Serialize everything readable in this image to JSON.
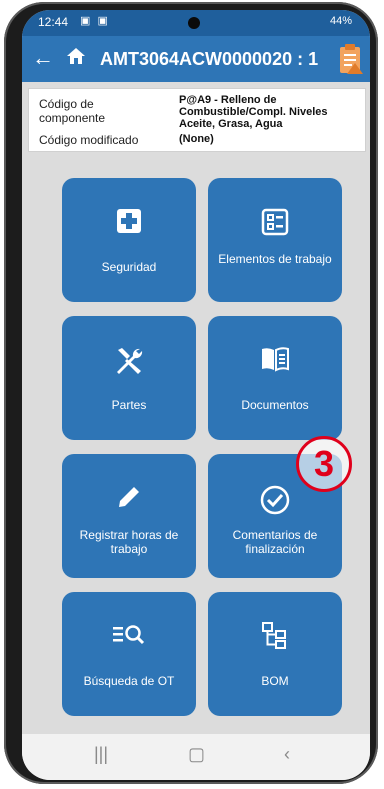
{
  "status": {
    "time": "12:44",
    "icons": "▣ ▣",
    "right": "44%"
  },
  "appbar": {
    "title": "AMT3064ACW0000020 : 1"
  },
  "info": {
    "component_label": "Código de componente",
    "component_value": "P@A9 - Relleno de Combustible/Compl. Niveles Aceite, Grasa, Agua",
    "modified_label": "Código modificado",
    "modified_value": "(None)"
  },
  "tiles": [
    {
      "label": "Seguridad",
      "icon": "first-aid-plus"
    },
    {
      "label": "Elementos de trabajo",
      "icon": "checklist"
    },
    {
      "label": "Partes",
      "icon": "tools"
    },
    {
      "label": "Documentos",
      "icon": "book"
    },
    {
      "label": "Registrar horas de trabajo",
      "icon": "pencil"
    },
    {
      "label": "Comentarios de finalización",
      "icon": "check-circle"
    },
    {
      "label": "Búsqueda de OT",
      "icon": "search-list"
    },
    {
      "label": "BOM",
      "icon": "hierarchy"
    }
  ],
  "callout": {
    "text": "3"
  },
  "colors": {
    "primary": "#2e75b6",
    "status": "#1f5f9c",
    "callout": "#e0001b"
  }
}
